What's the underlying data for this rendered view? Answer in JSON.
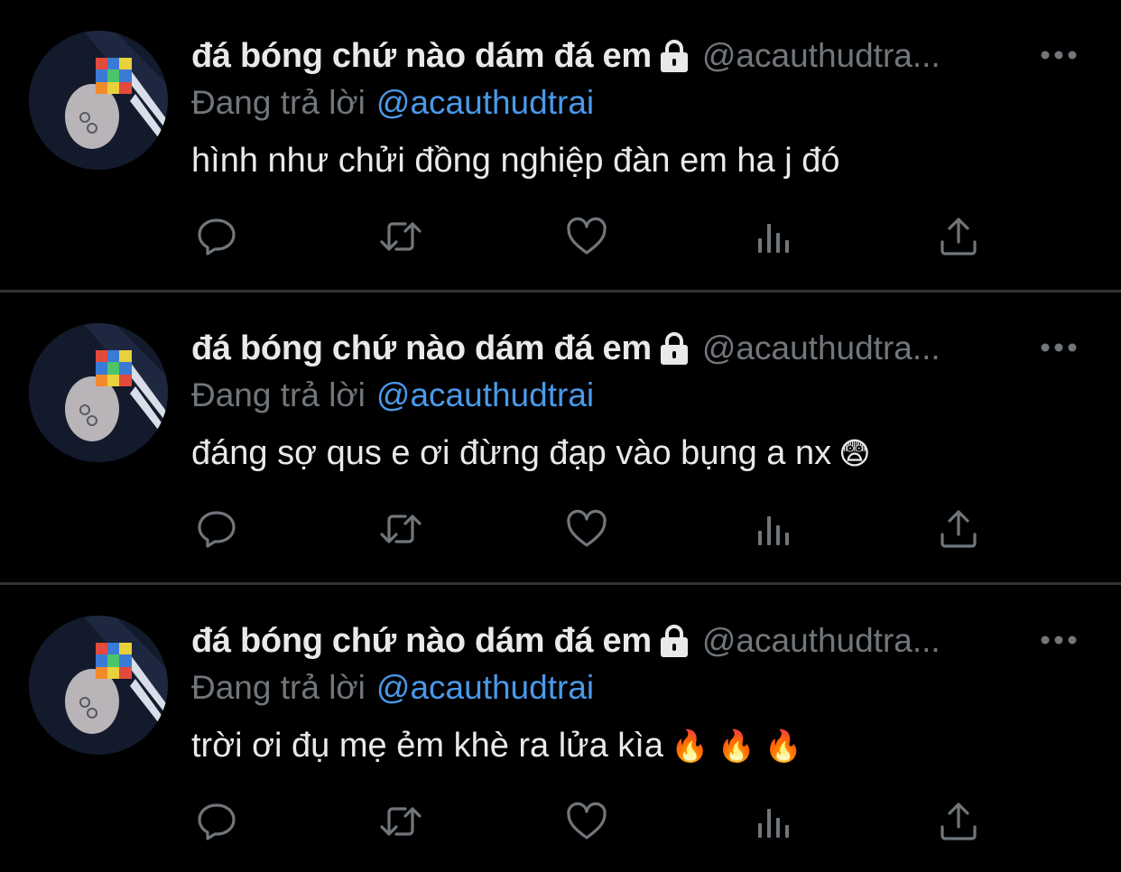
{
  "colors": {
    "background": "#000000",
    "text": "#e7e9ea",
    "muted": "#71767b",
    "link": "#4a99e9",
    "divider": "#2f3336"
  },
  "tweets": [
    {
      "display_name": "đá bóng chứ nào dám đá em",
      "protected_icon": "lock-icon",
      "handle": "@acauthudtra...",
      "replying_to_label": "Đang trả lời",
      "replying_to_handle": "@acauthudtrai",
      "text": "hình như chửi đồng nghiệp đàn em ha j đó",
      "emoji": ""
    },
    {
      "display_name": "đá bóng chứ nào dám đá em",
      "protected_icon": "lock-icon",
      "handle": "@acauthudtra...",
      "replying_to_label": "Đang trả lời",
      "replying_to_handle": "@acauthudtrai",
      "text": "đáng sợ qus e ơi đừng đạp vào bụng a nx",
      "emoji": "😨"
    },
    {
      "display_name": "đá bóng chứ nào dám đá em",
      "protected_icon": "lock-icon",
      "handle": "@acauthudtra...",
      "replying_to_label": "Đang trả lời",
      "replying_to_handle": "@acauthudtrai",
      "text": "trời ơi đụ mẹ ẻm khè ra lửa kìa",
      "emoji": "🔥 🔥 🔥"
    }
  ],
  "action_icons": [
    "reply-icon",
    "retweet-icon",
    "like-icon",
    "views-icon",
    "share-icon"
  ]
}
